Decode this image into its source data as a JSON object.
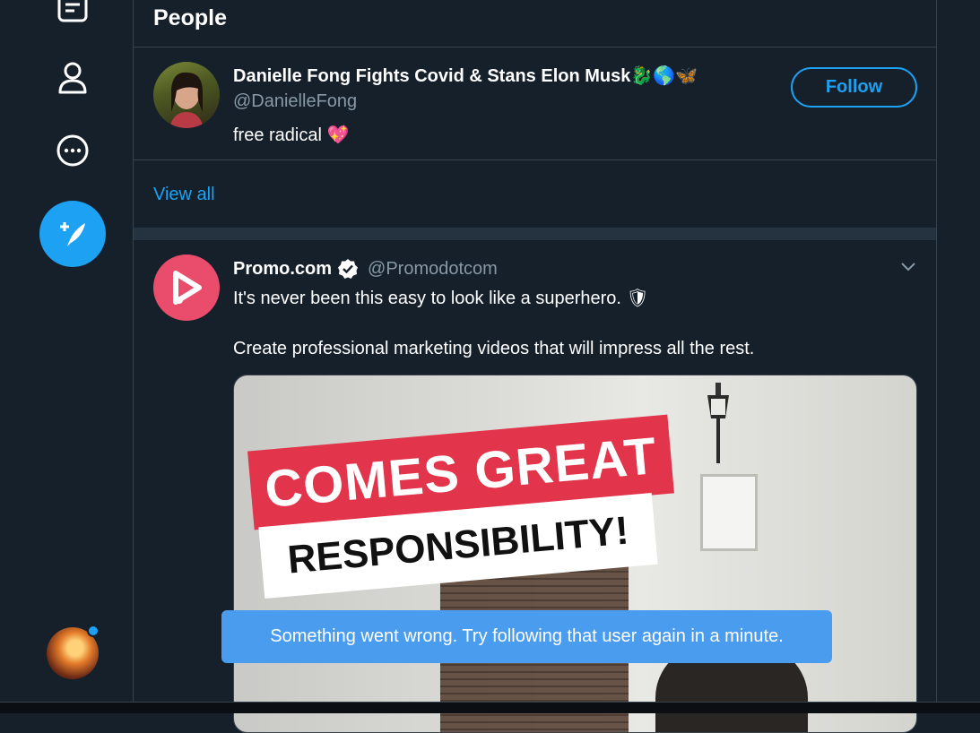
{
  "sidebar": {
    "items": [
      {
        "icon": "lists-icon"
      },
      {
        "icon": "profile-icon"
      },
      {
        "icon": "more-icon"
      }
    ],
    "compose_icon": "compose-tweet-icon"
  },
  "people": {
    "header": "People",
    "user": {
      "name": "Danielle Fong Fights Covid & Stans Elon Musk",
      "name_emoji": "🐉🌎🦋",
      "handle": "@DanielleFong",
      "bio": "free radical",
      "bio_emoji": "💖",
      "follow_label": "Follow"
    },
    "view_all": "View all"
  },
  "tweet": {
    "name": "Promo.com",
    "handle": "@Promodotcom",
    "line1": "It's never been this easy to look like a superhero.",
    "line1_emoji": "🛡",
    "line2": "Create professional marketing videos that will impress all the rest.",
    "media": {
      "banner_top": "COMES GREAT",
      "banner_bottom": "RESPONSIBILITY!"
    }
  },
  "toast": {
    "message": "Something went wrong. Try following that user again in a minute."
  },
  "colors": {
    "background": "#15202b",
    "accent": "#1da1f2",
    "border": "#38444d",
    "secondary_text": "#8899a6",
    "promo_brand": "#ea4d6b",
    "toast": "#4a9cee"
  }
}
